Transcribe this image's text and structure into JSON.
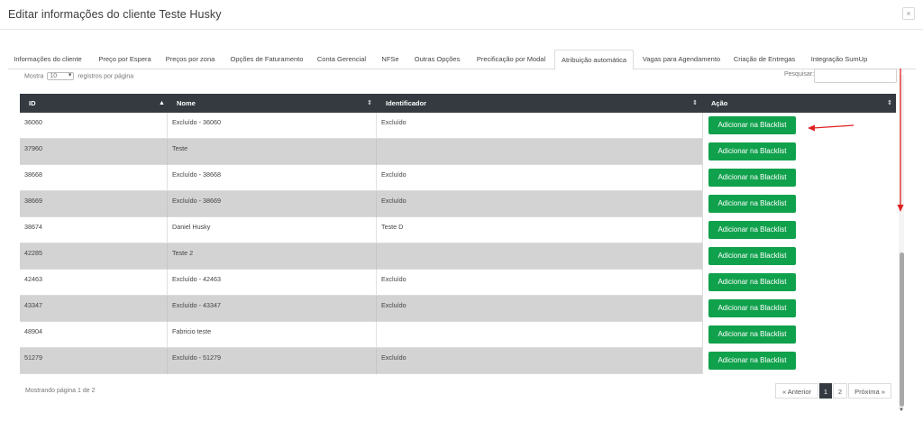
{
  "modal": {
    "title": "Editar informações do cliente Teste Husky",
    "close_glyph": "×"
  },
  "tabs": [
    {
      "label": "Informações do cliente"
    },
    {
      "label": "Preço por Espera"
    },
    {
      "label": "Preços por zona"
    },
    {
      "label": "Opções de Faturamento"
    },
    {
      "label": "Conta Gerencial"
    },
    {
      "label": "NFSe"
    },
    {
      "label": "Outras Opções"
    },
    {
      "label": "Precificação por Modal"
    },
    {
      "label": "Atribuição automática"
    },
    {
      "label": "Vagas para Agendamento"
    },
    {
      "label": "Criação de Entregas"
    },
    {
      "label": "Integração SumUp"
    }
  ],
  "active_tab": "Atribuição automática",
  "length_menu": {
    "prefix": "Mostra",
    "value": "10",
    "suffix": "registros por página"
  },
  "search": {
    "label": "Pesquisar:",
    "value": ""
  },
  "table": {
    "headers": [
      "ID",
      "Nome",
      "Identificador",
      "Ação"
    ],
    "rows": [
      {
        "id": "36060",
        "nome": "Excluído - 36060",
        "identificador": "Excluído",
        "acao": "Adicionar na Blacklist"
      },
      {
        "id": "37960",
        "nome": "Teste",
        "identificador": "",
        "acao": "Adicionar na Blacklist"
      },
      {
        "id": "38668",
        "nome": "Excluído - 38668",
        "identificador": "Excluído",
        "acao": "Adicionar na Blacklist"
      },
      {
        "id": "38669",
        "nome": "Excluído - 38669",
        "identificador": "Excluído",
        "acao": "Adicionar na Blacklist"
      },
      {
        "id": "38674",
        "nome": "Daniel Husky",
        "identificador": "Teste D",
        "acao": "Adicionar na Blacklist"
      },
      {
        "id": "42285",
        "nome": "Teste 2",
        "identificador": "",
        "acao": "Adicionar na Blacklist"
      },
      {
        "id": "42463",
        "nome": "Excluído - 42463",
        "identificador": "Excluído",
        "acao": "Adicionar na Blacklist"
      },
      {
        "id": "43347",
        "nome": "Excluído - 43347",
        "identificador": "Excluído",
        "acao": "Adicionar na Blacklist"
      },
      {
        "id": "48904",
        "nome": "Fabricio teste",
        "identificador": "",
        "acao": "Adicionar na Blacklist"
      },
      {
        "id": "51279",
        "nome": "Excluído - 51279",
        "identificador": "Excluído",
        "acao": "Adicionar na Blacklist"
      }
    ]
  },
  "footer": {
    "info": "Mostrando página 1 de 2",
    "pagination": {
      "prev": "« Anterior",
      "pages": [
        "1",
        "2"
      ],
      "next": "Próxima »",
      "current": "1"
    }
  },
  "colors": {
    "header_bg": "#343a40",
    "button_green": "#10a14c",
    "annotation_red": "#e02020",
    "stripe_gray": "#d3d3d3"
  },
  "icons": {
    "sort_asc": "▲",
    "sort_both": "⇕",
    "close": "close-icon"
  }
}
